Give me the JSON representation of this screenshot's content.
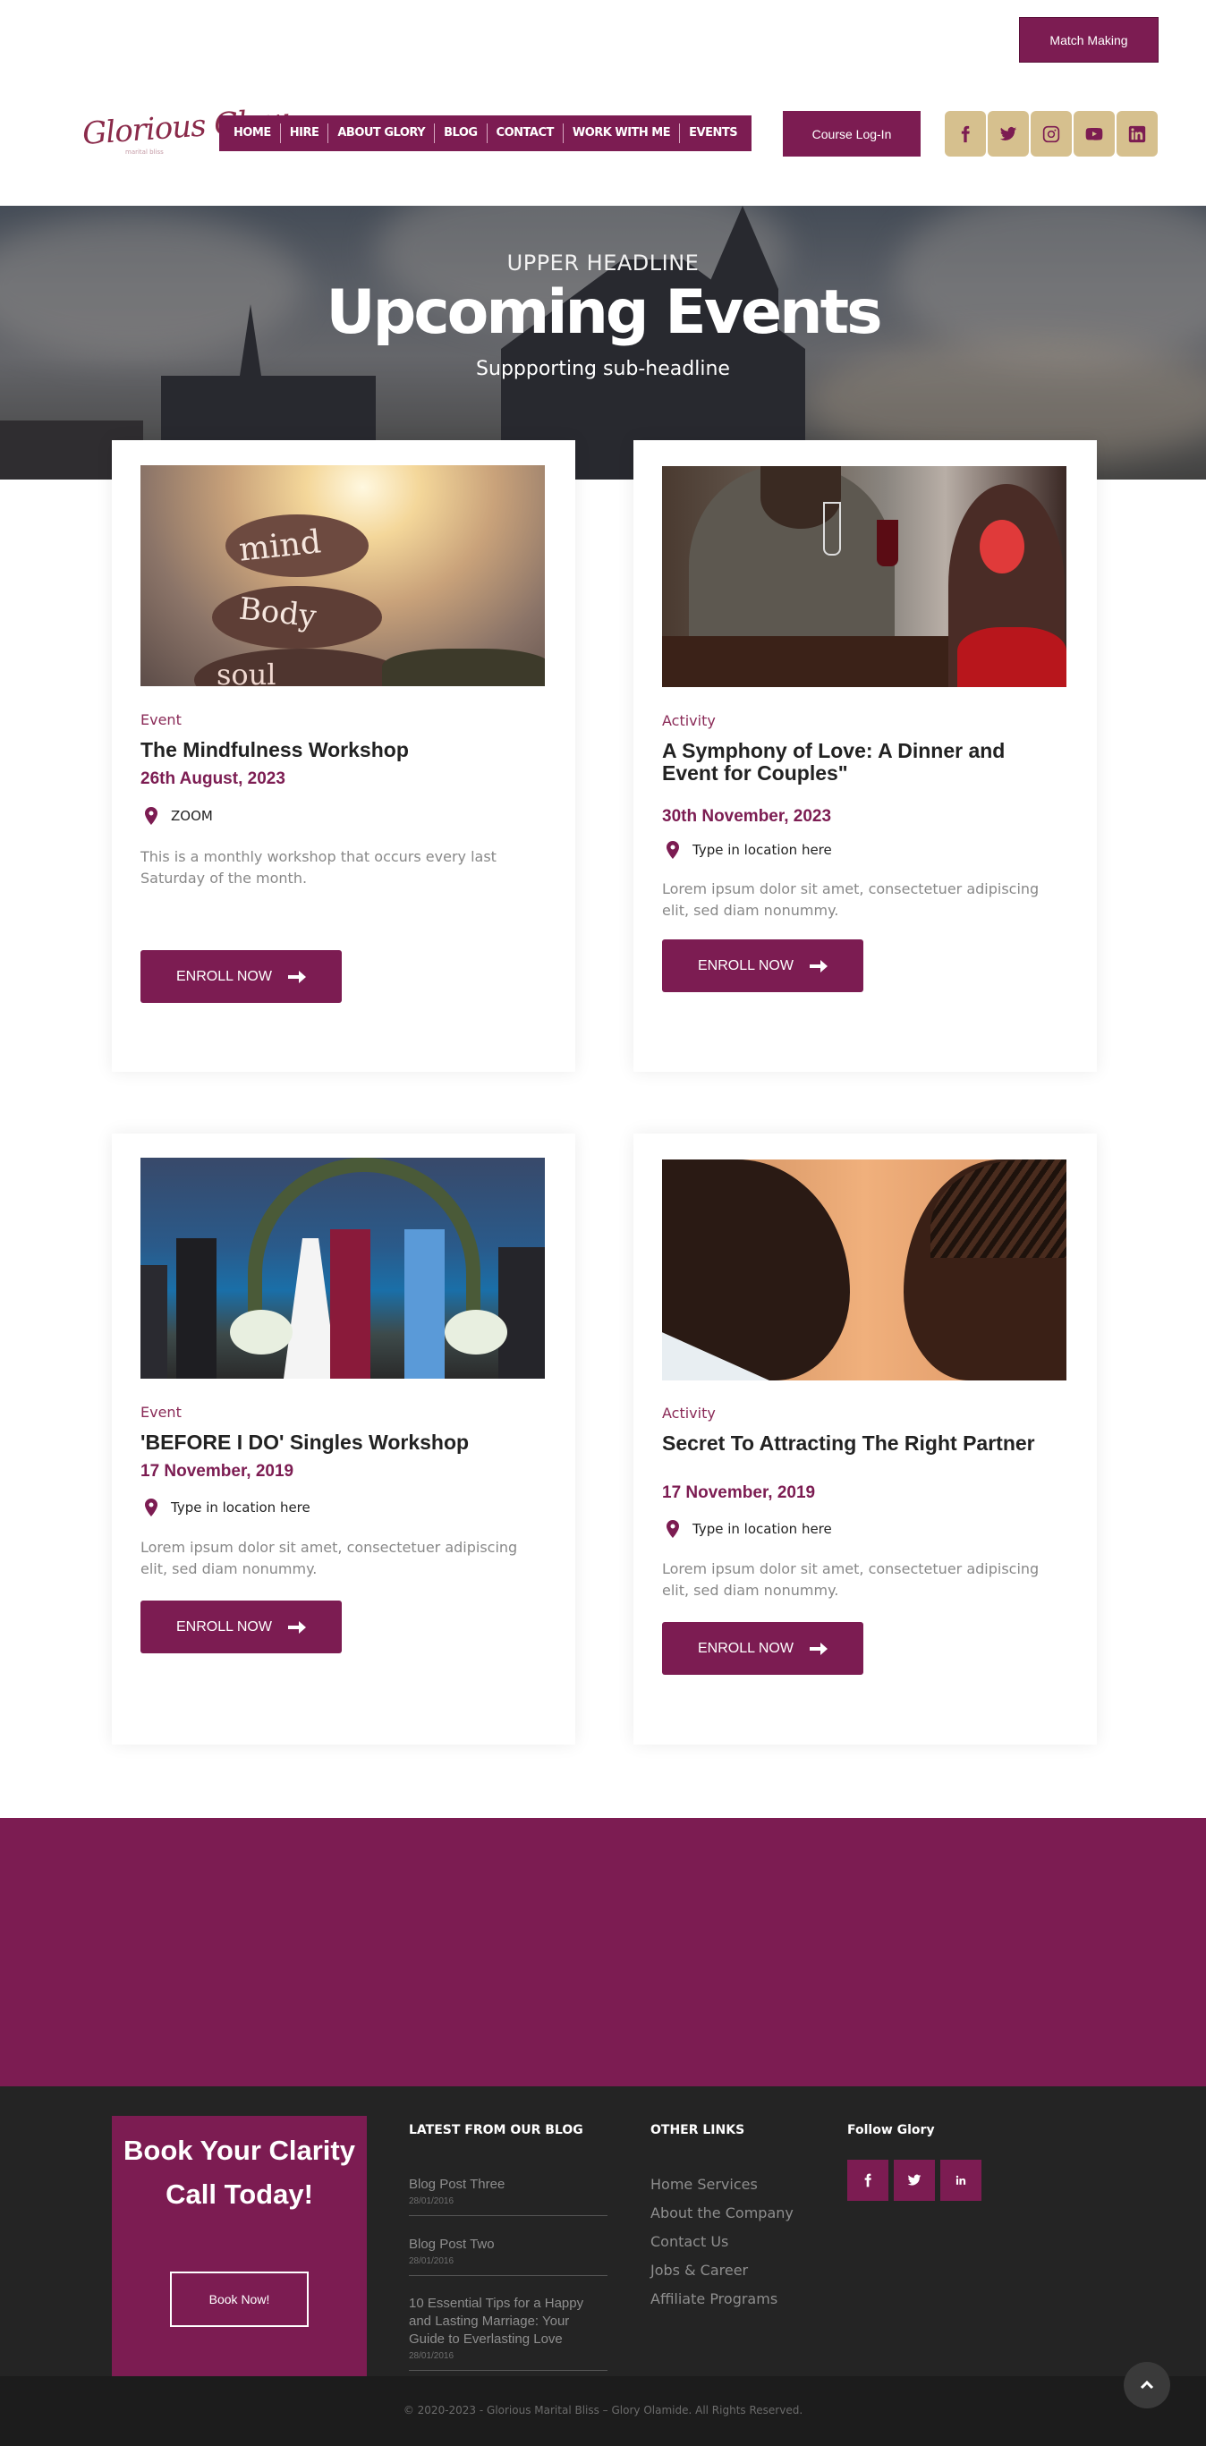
{
  "topbar": {
    "match_label": "Match Making"
  },
  "logo": {
    "text": "Glorious Glow",
    "tagline": "marital bliss"
  },
  "nav": {
    "items": [
      "HOME",
      "HIRE",
      "ABOUT GLORY",
      "BLOG",
      "CONTACT",
      "WORK WITH ME",
      "EVENTS"
    ]
  },
  "header": {
    "course_label": "Course Log-In",
    "social_icons": [
      "facebook-icon",
      "twitter-icon",
      "instagram-icon",
      "youtube-icon",
      "linkedin-icon"
    ]
  },
  "hero": {
    "upper": "UPPER HEADLINE",
    "title": "Upcoming Events",
    "sub": "Suppporting sub-headline"
  },
  "events": [
    {
      "type": "Event",
      "title": "The Mindfulness Workshop",
      "date": "26th August, 2023",
      "location": "ZOOM",
      "desc": "This is a monthly workshop that occurs every last Saturday of the month.",
      "button": "ENROLL NOW",
      "image_words": [
        "mind",
        "Body",
        "soul"
      ]
    },
    {
      "type": "Activity",
      "title": "A Symphony of Love: A Dinner and Event for Couples\"",
      "date": "30th November, 2023",
      "location": "Type in location here",
      "desc": "Lorem ipsum dolor sit amet, consectetuer adipiscing elit, sed diam nonummy.",
      "button": "ENROLL NOW"
    },
    {
      "type": "Event",
      "title": "'BEFORE I DO' Singles Workshop",
      "date": "17 November, 2019",
      "location": "Type in location here",
      "desc": "Lorem ipsum dolor sit amet, consectetuer adipiscing elit, sed diam nonummy.",
      "button": "ENROLL NOW"
    },
    {
      "type": "Activity",
      "title": "Secret To Attracting The Right Partner",
      "date": "17 November, 2019",
      "location": "Type in location here",
      "desc": "Lorem ipsum dolor sit amet, consectetuer adipiscing elit, sed diam nonummy.",
      "button": "ENROLL NOW"
    }
  ],
  "footer": {
    "book_title": "Book Your Clarity Call Today!",
    "book_button": "Book Now!",
    "blog_heading": "LATEST FROM OUR BLOG",
    "blog_posts": [
      {
        "title": "Blog Post Three",
        "date": "28/01/2016"
      },
      {
        "title": "Blog Post Two",
        "date": "28/01/2016"
      },
      {
        "title": "10 Essential Tips for a Happy and Lasting Marriage: Your Guide to Everlasting Love",
        "date": "28/01/2016"
      }
    ],
    "links_heading": "OTHER LINKS",
    "links": [
      "Home Services",
      "About the Company",
      "Contact Us",
      "Jobs & Career",
      "Affiliate Programs"
    ],
    "follow_heading": "Follow Glory",
    "follow_icons": [
      "facebook-icon",
      "twitter-icon",
      "linkedin-icon"
    ],
    "copyright": "© 2020-2023 - Glorious Marital Bliss – Glory Olamide. All Rights Reserved."
  },
  "colors": {
    "brand": "#7c1c52",
    "gold": "#d6c08e",
    "footer": "#242424"
  }
}
